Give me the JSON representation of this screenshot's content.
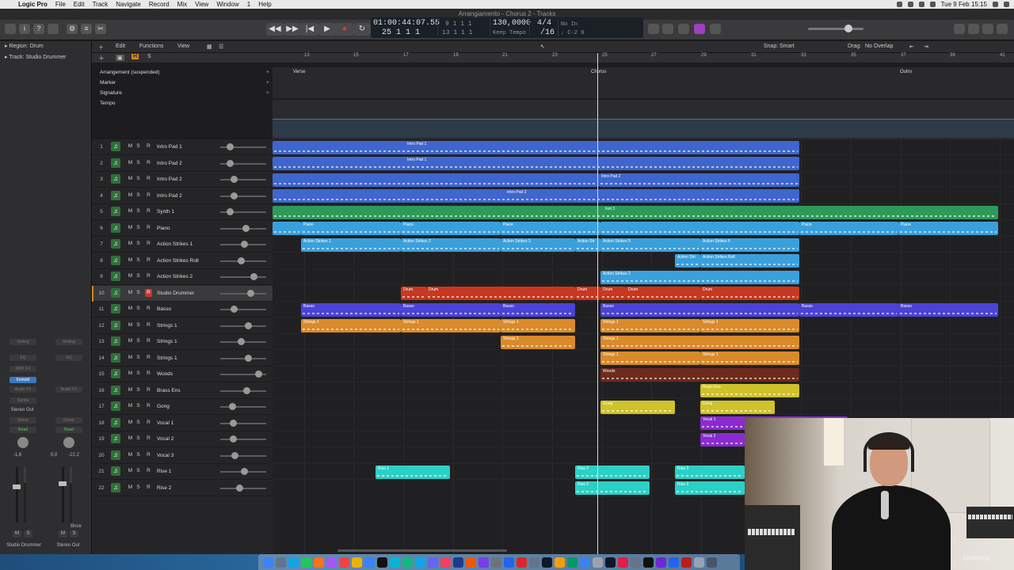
{
  "menubar": {
    "app": "Logic Pro",
    "items": [
      "File",
      "Edit",
      "Track",
      "Navigate",
      "Record",
      "Mix",
      "View",
      "Window",
      "1",
      "Help"
    ],
    "clock": "Tue 9 Feb  15:15"
  },
  "window_title": "Arrangiamento - Chorus 2 - Tracks",
  "lcd": {
    "time": "01:00:44:07.55",
    "bars": "25  1  1       1",
    "pos2": "9  1  1      1",
    "pos3": "13  1  1      1",
    "tempo": "130,0000",
    "tempo_mode": "Keep Tempo",
    "signature": "4/4",
    "division": "/16",
    "input": "No In",
    "output": "♩ C-2  0"
  },
  "inspector": {
    "region_label": "Region:",
    "region_value": "Drum",
    "track_label": "Track:",
    "track_value": "Studio Drummer",
    "strip1": {
      "setting": "Setting",
      "eq": "EQ",
      "midi_fx": "MIDI FX",
      "instrument": "Kontakt",
      "audio_fx": "Audio FX",
      "sends": "Sends",
      "output": "Stereo Out",
      "group": "Group",
      "automation": "Read",
      "value_left": "-1,6",
      "name": "Studio Drummer",
      "m": "M",
      "s": "S"
    },
    "strip2": {
      "setting": "Setting",
      "eq": "EQ",
      "audio_fx": "Audio FX",
      "group": "Group",
      "automation": "Read",
      "value_left": "0,0",
      "value_right": "-22,2",
      "bounce": "Bnce",
      "name": "Stereo Out",
      "m": "M",
      "s": "S"
    }
  },
  "localbar": {
    "edit": "Edit",
    "functions": "Functions",
    "view": "View",
    "snap_label": "Snap:",
    "snap_value": "Smart",
    "drag_label": "Drag:",
    "drag_value": "No Overlap"
  },
  "ruler": [
    "13",
    "15",
    "17",
    "19",
    "21",
    "23",
    "25",
    "27",
    "29",
    "31",
    "33",
    "35",
    "37",
    "39",
    "41"
  ],
  "global_tracks": [
    {
      "label": "Arrangement (suspended)"
    },
    {
      "label": "Marker"
    },
    {
      "label": "Signature"
    },
    {
      "label": "Tempo"
    }
  ],
  "arrangement_markers": [
    "Verse",
    "Chorus",
    "Outro"
  ],
  "tracks": [
    {
      "num": "1",
      "name": "Intro Pad 1"
    },
    {
      "num": "2",
      "name": "Intro Pad 2"
    },
    {
      "num": "3",
      "name": "Intro Pad 2"
    },
    {
      "num": "4",
      "name": "Intro Pad 2"
    },
    {
      "num": "5",
      "name": "Synth 1"
    },
    {
      "num": "6",
      "name": "Piano"
    },
    {
      "num": "7",
      "name": "Action Strikes 1"
    },
    {
      "num": "8",
      "name": "Action Strikes Roll"
    },
    {
      "num": "9",
      "name": "Action Strikes 2"
    },
    {
      "num": "10",
      "name": "Studio Drummer"
    },
    {
      "num": "11",
      "name": "Basso"
    },
    {
      "num": "12",
      "name": "Strings 1"
    },
    {
      "num": "13",
      "name": "Strings 1"
    },
    {
      "num": "14",
      "name": "Strings 1"
    },
    {
      "num": "15",
      "name": "Woods"
    },
    {
      "num": "16",
      "name": "Brass Ens"
    },
    {
      "num": "17",
      "name": "Gong"
    },
    {
      "num": "18",
      "name": "Vocal 1"
    },
    {
      "num": "19",
      "name": "Vocal 2"
    },
    {
      "num": "20",
      "name": "Vocal 3"
    },
    {
      "num": "21",
      "name": "Rise 1"
    },
    {
      "num": "22",
      "name": "Rise 2"
    }
  ],
  "track_buttons": {
    "mute": "M",
    "solo": "S",
    "record": "R"
  },
  "region_labels": {
    "intro_pad_1": "Intro Pad 1",
    "intro_pad_2": "Intro Pad 2",
    "inst_1": "Inst 1",
    "piano": "Piano",
    "action_strikes_1": "Action Strikes 1",
    "action_strikes_2": "Action Strikes 2",
    "action_strikes_3": "Action Strikes 3",
    "action_strikes_5": "Action Strikes 5",
    "action_strikes_6": "Action Strikes 6",
    "action_str": "Action Str",
    "action_stri": "Action Stri",
    "action_strikes_roll": "Action Strikes Roll",
    "drum": "Drum",
    "basso": "Basso",
    "strings_1": "Strings 1",
    "woods": "Woods",
    "brass_ens": "Brass Ens",
    "gong": "Gong",
    "vocal_1": "Vocal 1",
    "vocal_2": "Vocal 2",
    "rise_1": "Rise 1",
    "rise_2": "Rise 2",
    "rise_3": "Rise 3"
  },
  "colors": {
    "blue": "#3f66cf",
    "green": "#2e9a5a",
    "light_blue": "#3aa0dc",
    "red": "#c8371f",
    "purple": "#4b43d6",
    "orange": "#d98a2a",
    "dark_red": "#6e2a1c",
    "yellow": "#cfc22a",
    "violet": "#8a2ad0",
    "cyan": "#2ccfc5"
  },
  "webcam": {
    "watermark": "Udemy"
  }
}
